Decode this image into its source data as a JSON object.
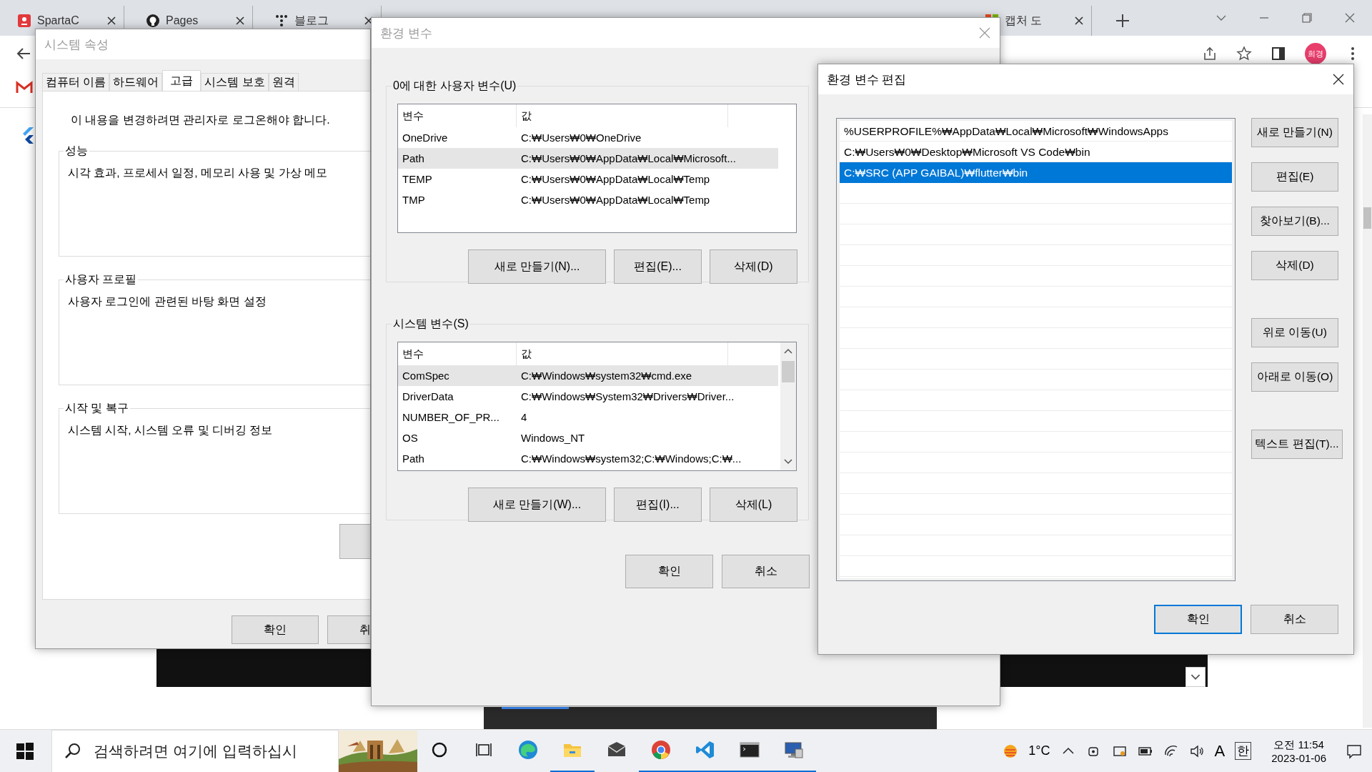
{
  "browser": {
    "tabs": [
      {
        "label": "SpartaC",
        "selected": false
      },
      {
        "label": "Pages",
        "selected": false
      },
      {
        "label": "블로그",
        "selected": false
      },
      {
        "label": "캡처 도",
        "selected": false
      }
    ],
    "profile": "희경"
  },
  "system_properties": {
    "title": "시스템 속성",
    "tabs": [
      {
        "label": "컴퓨터 이름",
        "selected": false
      },
      {
        "label": "하드웨어",
        "selected": false
      },
      {
        "label": "고급",
        "selected": true
      },
      {
        "label": "시스템 보호",
        "selected": false
      },
      {
        "label": "원격",
        "selected": false
      }
    ],
    "notice": "이 내용을 변경하려면 관리자로 로그온해야 합니다.",
    "groups": [
      {
        "title": "성능",
        "description": "시각 효과, 프로세서 일정, 메모리 사용 및 가상 메모"
      },
      {
        "title": "사용자 프로필",
        "description": "사용자 로그인에 관련된 바탕 화면 설정"
      },
      {
        "title": "시작 및 복구",
        "description": "시스템 시작, 시스템 오류 및 디버깅 정보"
      }
    ],
    "buttons": [
      "확인",
      "취"
    ]
  },
  "environment_variables": {
    "title": "환경 변수",
    "user_section": {
      "title": "0에 대한 사용자 변수(U)",
      "columns": [
        "변수",
        "값"
      ],
      "rows": [
        {
          "name": "OneDrive",
          "value": "C:₩Users₩0₩OneDrive",
          "selected": false
        },
        {
          "name": "Path",
          "value": "C:₩Users₩0₩AppData₩Local₩Microsoft...",
          "selected": true
        },
        {
          "name": "TEMP",
          "value": "C:₩Users₩0₩AppData₩Local₩Temp",
          "selected": false
        },
        {
          "name": "TMP",
          "value": "C:₩Users₩0₩AppData₩Local₩Temp",
          "selected": false
        }
      ],
      "buttons": [
        "새로 만들기(N)...",
        "편집(E)...",
        "삭제(D)"
      ]
    },
    "system_section": {
      "title": "시스템 변수(S)",
      "columns": [
        "변수",
        "값"
      ],
      "rows": [
        {
          "name": "ComSpec",
          "value": "C:₩Windows₩system32₩cmd.exe",
          "selected": true
        },
        {
          "name": "DriverData",
          "value": "C:₩Windows₩System32₩Drivers₩Driver...",
          "selected": false
        },
        {
          "name": "NUMBER_OF_PR...",
          "value": "4",
          "selected": false
        },
        {
          "name": "OS",
          "value": "Windows_NT",
          "selected": false
        },
        {
          "name": "Path",
          "value": "C:₩Windows₩system32;C:₩Windows;C:₩...",
          "selected": false
        }
      ],
      "buttons": [
        "새로 만들기(W)...",
        "편집(I)...",
        "삭제(L)"
      ]
    },
    "buttons": [
      "확인",
      "취소"
    ]
  },
  "edit_variable": {
    "title": "환경 변수 편집",
    "entries": [
      {
        "text": "%USERPROFILE%₩AppData₩Local₩Microsoft₩WindowsApps",
        "selected": false
      },
      {
        "text": "C:₩Users₩0₩Desktop₩Microsoft VS Code₩bin",
        "selected": false
      },
      {
        "text": "C:₩SRC (APP GAIBAL)₩flutter₩bin",
        "selected": true
      }
    ],
    "side_buttons": [
      "새로 만들기(N)",
      "편집(E)",
      "찾아보기(B)...",
      "삭제(D)",
      "위로 이동(U)",
      "아래로 이동(O)",
      "텍스트 편집(T)..."
    ],
    "buttons": [
      {
        "label": "확인",
        "default": true
      },
      {
        "label": "취소",
        "default": false
      }
    ]
  },
  "taskbar": {
    "search_placeholder": "검색하려면 여기에 입력하십시",
    "apps": [
      {
        "kind": "edge",
        "running": false
      },
      {
        "kind": "folder",
        "running": true
      },
      {
        "kind": "mail",
        "running": false
      },
      {
        "kind": "chrome",
        "running": true
      },
      {
        "kind": "vscode",
        "running": true
      },
      {
        "kind": "terminal",
        "running": true
      },
      {
        "kind": "remote",
        "running": true
      }
    ],
    "temperature": "1°C",
    "input_mode": "A",
    "ime": "한",
    "time": "오전 11:54",
    "date": "2023-01-06"
  }
}
